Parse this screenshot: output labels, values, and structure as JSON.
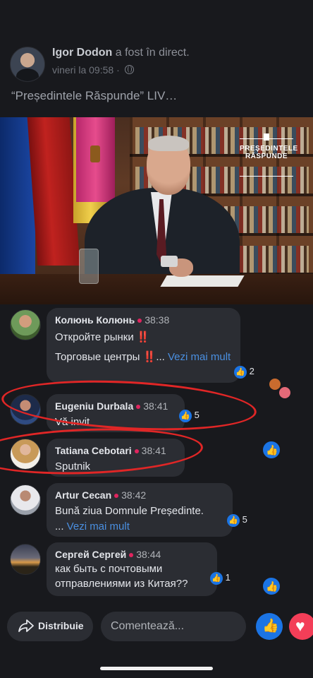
{
  "post": {
    "author": "Igor Dodon",
    "action": " a fost în direct.",
    "day": "vineri",
    "time": "la 09:58",
    "separator": "·",
    "text": "“Președintele Răspunde” LIV…"
  },
  "video": {
    "logo_line1": "PREȘEDINTELE",
    "logo_line2": "RĂSPUNDE"
  },
  "comments": [
    {
      "name": "Колюнь Колюнь",
      "time": "38:38",
      "line1": "Откройте рынки ",
      "emoji1": "‼️",
      "line2": "Торговые центры ",
      "emoji2": "‼️",
      "ellipsis": "... ",
      "more": "Vezi mai mult",
      "likes": "2"
    },
    {
      "name": "Eugeniu Durbala",
      "time": "38:41",
      "text": "Vă invit",
      "likes": "5"
    },
    {
      "name": "Tatiana Cebotari",
      "time": "38:41",
      "text": "Sputnik"
    },
    {
      "name": "Artur  Cecan",
      "time": "38:42",
      "line1": "Bună ziua Domnule Președinte.",
      "ellipsis": "... ",
      "more": "Vezi mai mult",
      "likes": "5"
    },
    {
      "name": "Сергей Сергей",
      "time": "38:44",
      "line1": "как быть с почтовыми",
      "line2": "отправлениями из Китая??",
      "likes": "1"
    }
  ],
  "bottom_bar": {
    "share_label": "Distribuie",
    "comment_placeholder": "Comentează..."
  },
  "colors": {
    "like_blue": "#1b74e4",
    "live_red": "#e0245e",
    "link_blue": "#4a8fe0",
    "annotation_red": "#e02626"
  },
  "icons": [
    "globe-icon",
    "like-icon",
    "share-icon",
    "heart-icon",
    "angry-reaction-icon",
    "live-dot-icon"
  ]
}
